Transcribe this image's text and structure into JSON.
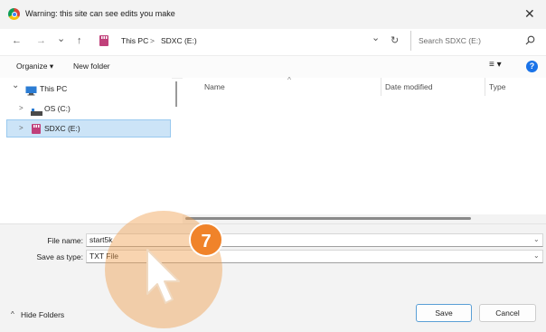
{
  "window": {
    "title": "Warning: this site can see edits you make",
    "close_glyph": "✕"
  },
  "nav": {
    "back": "←",
    "forward": "→",
    "recent": "⌄",
    "up": "↑",
    "breadcrumb": [
      "This PC",
      "SDXC (E:)"
    ],
    "separator": ">",
    "dropdown": "⌄",
    "refresh": "↻"
  },
  "search": {
    "placeholder": "Search SDXC (E:)",
    "icon": "search-icon"
  },
  "command_bar": {
    "organize": "Organize ▾",
    "new_folder": "New folder",
    "view": "≡ ▾",
    "help": "?"
  },
  "tree": [
    {
      "label": "This PC",
      "chevron": "⌄",
      "icon": "computer-icon"
    },
    {
      "label": "OS (C:)",
      "chevron": ">",
      "icon": "drive-icon"
    },
    {
      "label": "SDXC (E:)",
      "chevron": ">",
      "icon": "sd-card-icon",
      "selected": true
    }
  ],
  "columns": {
    "name": "Name",
    "date_modified": "Date modified",
    "type": "Type",
    "sort_glyph": "^"
  },
  "file_name": {
    "label": "File name:",
    "value": "start5k"
  },
  "save_as_type": {
    "label": "Save as type:",
    "value": "TXT File"
  },
  "footer": {
    "hide_folders": "Hide Folders",
    "save": "Save",
    "cancel": "Cancel"
  },
  "overlay": {
    "step_number": "7"
  }
}
